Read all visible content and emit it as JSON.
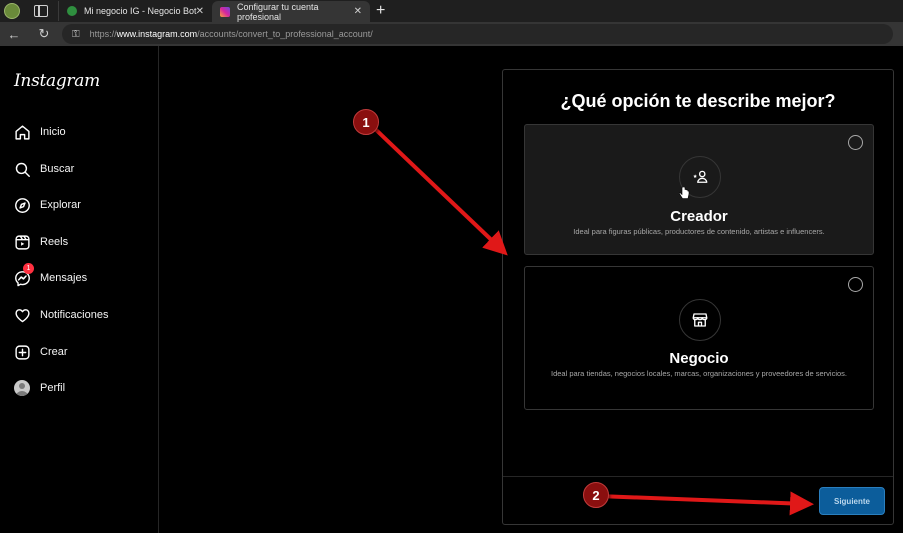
{
  "browser": {
    "tabs": [
      {
        "title": "Mi negocio IG - Negocio Bot",
        "active": false
      },
      {
        "title": "Configurar tu cuenta profesional",
        "active": true
      }
    ],
    "close_glyph": "✕",
    "new_tab_glyph": "+",
    "url_prefix": "https://",
    "url_host": "www.instagram.com",
    "url_path": "/accounts/convert_to_professional_account/"
  },
  "sidebar": {
    "logo": "Instagram",
    "items": [
      {
        "label": "Inicio",
        "icon": "home-icon"
      },
      {
        "label": "Buscar",
        "icon": "search-icon"
      },
      {
        "label": "Explorar",
        "icon": "compass-icon"
      },
      {
        "label": "Reels",
        "icon": "reels-icon"
      },
      {
        "label": "Mensajes",
        "icon": "messenger-icon",
        "badge": "1"
      },
      {
        "label": "Notificaciones",
        "icon": "heart-icon"
      },
      {
        "label": "Crear",
        "icon": "plus-square-icon"
      },
      {
        "label": "Perfil",
        "icon": "avatar-icon"
      }
    ]
  },
  "modal": {
    "title": "¿Qué opción te describe mejor?",
    "options": [
      {
        "title": "Creador",
        "description": "Ideal para figuras públicas, productores de contenido, artistas e influencers.",
        "selected": false,
        "icon": "creator-icon"
      },
      {
        "title": "Negocio",
        "description": "Ideal para tiendas, negocios locales, marcas, organizaciones y proveedores de servicios.",
        "selected": false,
        "icon": "store-icon"
      }
    ],
    "next_button": "Siguiente"
  },
  "annotations": {
    "markers": [
      "1",
      "2"
    ],
    "color": "#e01818"
  }
}
